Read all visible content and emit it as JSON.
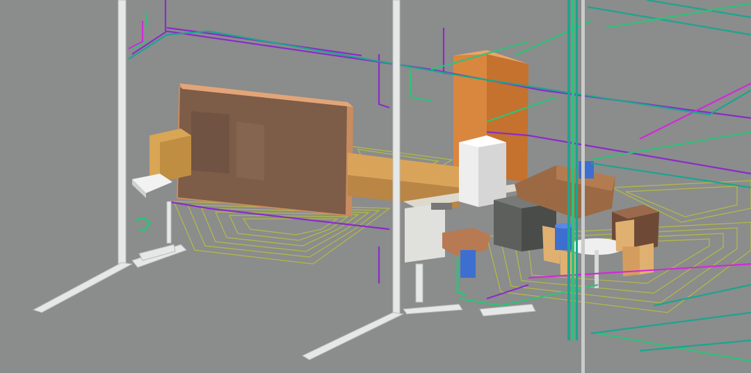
{
  "scene": {
    "colors": {
      "background": "#8b8c8c",
      "supply_pipe_teal": "#1aa58f",
      "supply_pipe_green": "#2ec27a",
      "drain_pipe_purple": "#8a2bc9",
      "drain_pipe_magenta": "#d12ad6",
      "floor_heating_yellow": "#b9c23a",
      "wood_orange": "#d9863f",
      "wood_light": "#d9a45a",
      "wall_glass": "#7a5a45",
      "soil_pipe_white": "#e6e8e8",
      "fridge_white": "#eeeeee",
      "dark_gray_cabinet": "#5c5f5c"
    }
  }
}
